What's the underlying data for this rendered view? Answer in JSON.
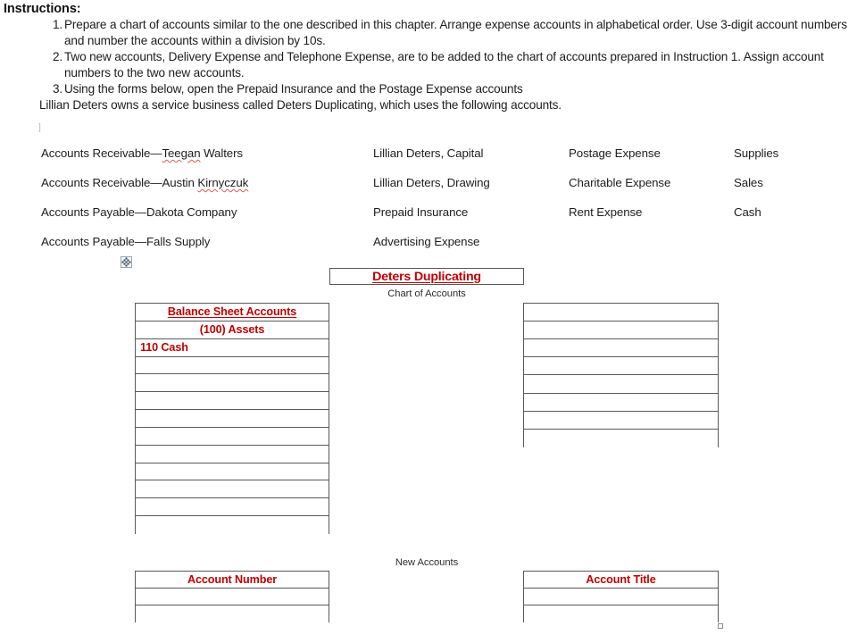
{
  "instructions": {
    "heading": "Instructions:",
    "items": [
      {
        "num": "1.",
        "text": "Prepare a chart of accounts similar to the one described in this chapter. Arrange expense accounts in alphabetical order. Use 3-digit account numbers and number the accounts within a division by 10s."
      },
      {
        "num": "2.",
        "text": "Two new accounts, Delivery Expense and Telephone Expense, are to be added to the chart of accounts prepared in Instruction 1. Assign account numbers to the two new accounts."
      },
      {
        "num": "3.",
        "text": "Using the forms below, open the Prepaid Insurance and the Postage Expense accounts"
      }
    ],
    "intro": "Lillian Deters owns a service business called Deters Duplicating, which uses the following accounts.",
    "cursor_artifact": "]"
  },
  "account_list": {
    "rows": [
      {
        "col_a_prefix": "Accounts Receivable—",
        "col_a_misspelled": "Teegan",
        "col_a_suffix": " Walters",
        "col_b": "Lillian Deters, Capital",
        "col_c": "Postage Expense",
        "col_d": "Supplies"
      },
      {
        "col_a_prefix": "Accounts Receivable—Austin ",
        "col_a_misspelled": "Kirnyczuk",
        "col_a_suffix": "",
        "col_b": "Lillian Deters, Drawing",
        "col_c": "Charitable Expense",
        "col_d": "Sales"
      },
      {
        "col_a_prefix": "Accounts Payable—Dakota Company",
        "col_a_misspelled": "",
        "col_a_suffix": "",
        "col_b": "Prepaid Insurance",
        "col_c": "Rent Expense",
        "col_d": "Cash"
      },
      {
        "col_a_prefix": "Accounts Payable—Falls Supply",
        "col_a_misspelled": "",
        "col_a_suffix": "",
        "col_b": "Advertising Expense",
        "col_c": "",
        "col_d": ""
      }
    ]
  },
  "form": {
    "company_name": "Deters Duplicating",
    "chart_subtitle": "Chart of Accounts",
    "new_accounts_label": "New Accounts",
    "accent_red": "#C00000",
    "border_color": "#5A5A5A",
    "move_handle_icon": "move-handle-icon",
    "resize_handle_icon": "resize-handle-icon"
  },
  "balance_ledger": {
    "rows": [
      {
        "text": "Balance Sheet Accounts",
        "align": "center",
        "underline": true
      },
      {
        "text": "(100) Assets",
        "align": "center",
        "underline": false
      },
      {
        "text": "110 Cash",
        "align": "left",
        "underline": false
      },
      {
        "text": "",
        "align": "left",
        "underline": false
      },
      {
        "text": "",
        "align": "left",
        "underline": false
      },
      {
        "text": "",
        "align": "left",
        "underline": false
      },
      {
        "text": "",
        "align": "left",
        "underline": false
      },
      {
        "text": "",
        "align": "left",
        "underline": false
      },
      {
        "text": "",
        "align": "left",
        "underline": false
      },
      {
        "text": "",
        "align": "left",
        "underline": false
      },
      {
        "text": "",
        "align": "left",
        "underline": false
      },
      {
        "text": "",
        "align": "left",
        "underline": false
      },
      {
        "text": "",
        "align": "left",
        "underline": false
      }
    ]
  },
  "right_ledger": {
    "rows": [
      {
        "text": "",
        "align": "left",
        "underline": false
      },
      {
        "text": "",
        "align": "left",
        "underline": false
      },
      {
        "text": "",
        "align": "left",
        "underline": false
      },
      {
        "text": "",
        "align": "left",
        "underline": false
      },
      {
        "text": "",
        "align": "left",
        "underline": false
      },
      {
        "text": "",
        "align": "left",
        "underline": false
      },
      {
        "text": "",
        "align": "left",
        "underline": false
      },
      {
        "text": "",
        "align": "left",
        "underline": false
      }
    ]
  },
  "account_number_ledger": {
    "rows": [
      {
        "text": "Account Number",
        "align": "center",
        "underline": false
      },
      {
        "text": "",
        "align": "left",
        "underline": false
      },
      {
        "text": "",
        "align": "left",
        "underline": false
      }
    ]
  },
  "account_title_ledger": {
    "rows": [
      {
        "text": "Account Title",
        "align": "center",
        "underline": false
      },
      {
        "text": "",
        "align": "left",
        "underline": false
      },
      {
        "text": "",
        "align": "left",
        "underline": false
      }
    ]
  }
}
